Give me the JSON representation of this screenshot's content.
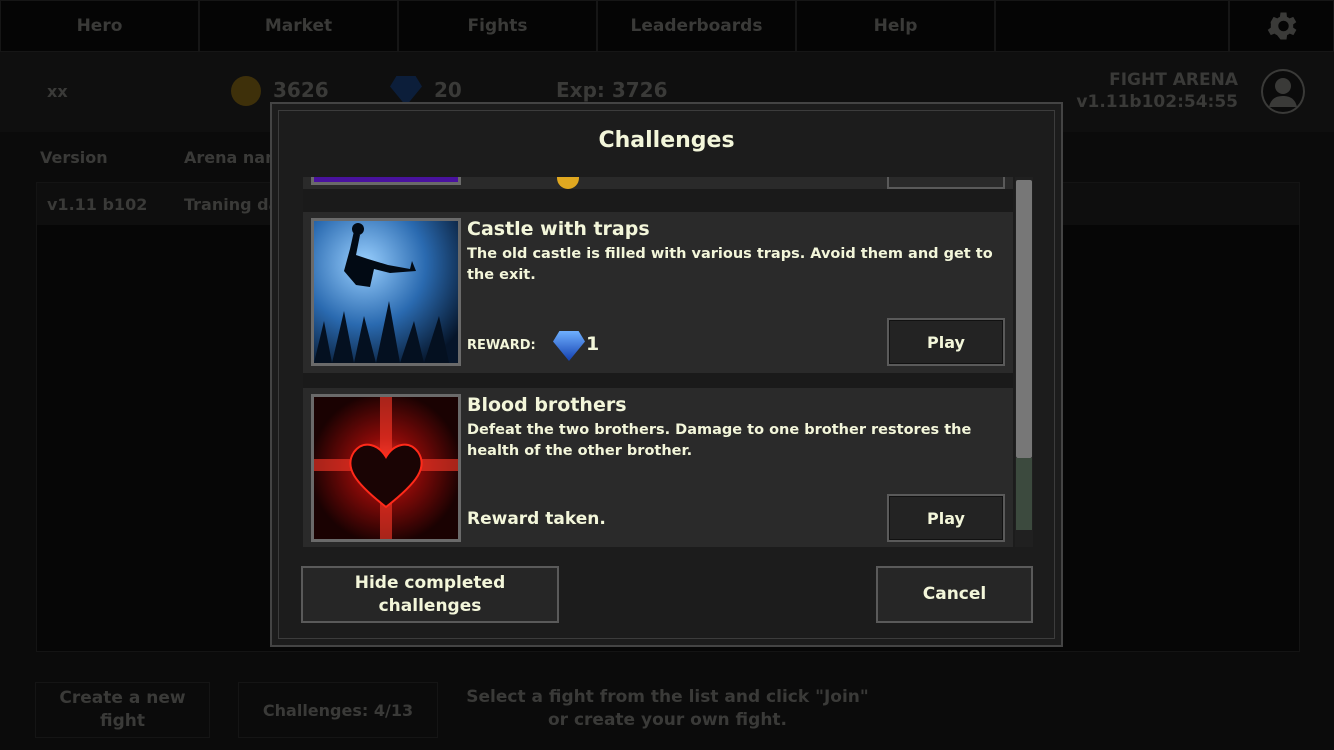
{
  "nav": {
    "tabs": [
      "Hero",
      "Market",
      "Fights",
      "Leaderboards",
      "Help"
    ],
    "settings_icon": "gear-icon"
  },
  "player": {
    "name": "xx",
    "gold": "3626",
    "gems": "20",
    "exp": "Exp: 3726"
  },
  "app": {
    "title": "FIGHT ARENA",
    "version": "v1.11b102:54:55"
  },
  "table": {
    "headers": [
      "Version",
      "Arena nam"
    ],
    "rows": [
      [
        "v1.11 b102",
        "Traning da"
      ]
    ]
  },
  "footer": {
    "create_button": "Create a new fight",
    "challenges_button": "Challenges: 4/13",
    "hint": "Select a fight from the list and click \"Join\" or create your own fight."
  },
  "dialog": {
    "title": "Challenges",
    "items": [
      {
        "title": "Castle with traps",
        "description": "The old castle is filled with various traps. Avoid them and get to the exit.",
        "reward_label": "REWARD:",
        "reward_value": "1",
        "reward_icon": "gem-icon",
        "play": "Play"
      },
      {
        "title": "Blood brothers",
        "description": "Defeat the two brothers. Damage to one brother restores the health of the other brother.",
        "status": "Reward taken.",
        "play": "Play"
      }
    ],
    "hide_button": "Hide completed challenges",
    "cancel_button": "Cancel",
    "colors": {
      "text": "#f3f6da",
      "panel": "#1c1c1c"
    }
  }
}
